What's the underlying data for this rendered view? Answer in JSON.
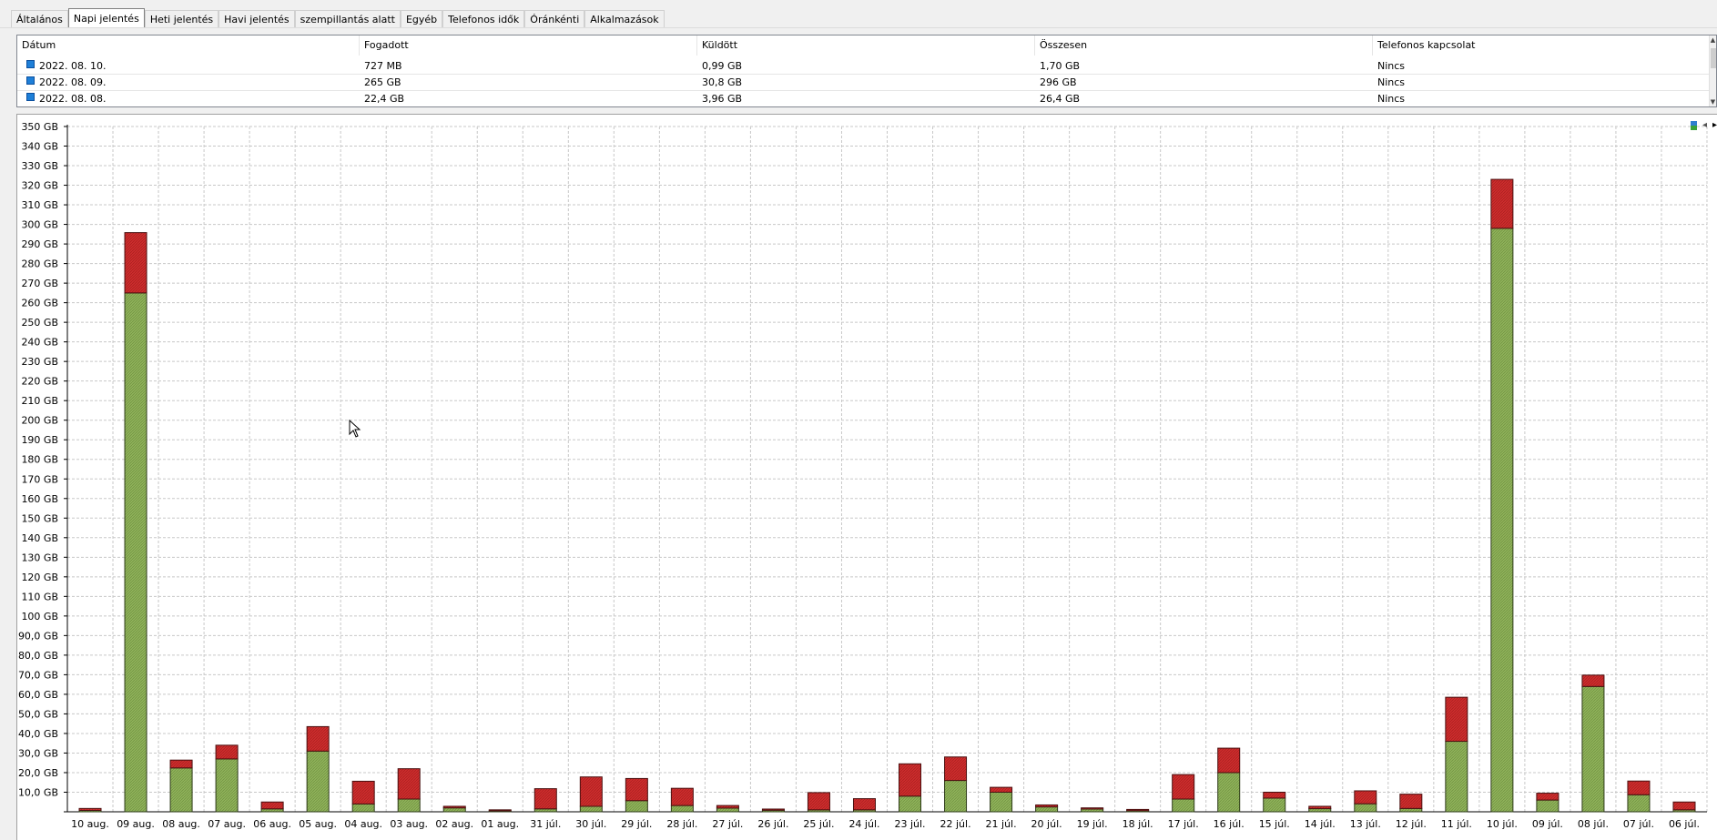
{
  "tabs": [
    {
      "label": "Általános",
      "active": false
    },
    {
      "label": "Napi jelentés",
      "active": true
    },
    {
      "label": "Heti jelentés",
      "active": false
    },
    {
      "label": "Havi jelentés",
      "active": false
    },
    {
      "label": "szempillantás alatt",
      "active": false
    },
    {
      "label": "Egyéb",
      "active": false
    },
    {
      "label": "Telefonos idők",
      "active": false
    },
    {
      "label": "Óránkénti",
      "active": false
    },
    {
      "label": "Alkalmazások",
      "active": false
    }
  ],
  "table": {
    "columns": [
      "Dátum",
      "Fogadott",
      "Küldött",
      "Összesen",
      "Telefonos kapcsolat"
    ],
    "rows": [
      [
        "2022. 08. 10.",
        "727 MB",
        "0,99 GB",
        "1,70 GB",
        "Nincs"
      ],
      [
        "2022. 08. 09.",
        "265 GB",
        "30,8 GB",
        "296 GB",
        "Nincs"
      ],
      [
        "2022. 08. 08.",
        "22,4 GB",
        "3,96 GB",
        "26,4 GB",
        "Nincs"
      ]
    ]
  },
  "chart_controls": {
    "legend_icon": "legend-icon",
    "prev_icon": "chevron-left-icon",
    "next_icon": "chevron-right-icon"
  },
  "chart_data": {
    "type": "bar",
    "stacked": true,
    "ylim": [
      0,
      350
    ],
    "ytick_labels": [
      "10,0 GB",
      "20,0 GB",
      "30,0 GB",
      "40,0 GB",
      "50,0 GB",
      "60,0 GB",
      "70,0 GB",
      "80,0 GB",
      "90,0 GB",
      "100 GB",
      "110 GB",
      "120 GB",
      "130 GB",
      "140 GB",
      "150 GB",
      "160 GB",
      "170 GB",
      "180 GB",
      "190 GB",
      "200 GB",
      "210 GB",
      "220 GB",
      "230 GB",
      "240 GB",
      "250 GB",
      "260 GB",
      "270 GB",
      "280 GB",
      "290 GB",
      "300 GB",
      "310 GB",
      "320 GB",
      "330 GB",
      "340 GB",
      "350 GB"
    ],
    "categories": [
      "10 aug.",
      "09 aug.",
      "08 aug.",
      "07 aug.",
      "06 aug.",
      "05 aug.",
      "04 aug.",
      "03 aug.",
      "02 aug.",
      "01 aug.",
      "31 júl.",
      "30 júl.",
      "29 júl.",
      "28 júl.",
      "27 júl.",
      "26 júl.",
      "25 júl.",
      "24 júl.",
      "23 júl.",
      "22 júl.",
      "21 júl.",
      "20 júl.",
      "19 júl.",
      "18 júl.",
      "17 júl.",
      "16 júl.",
      "15 júl.",
      "14 júl.",
      "13 júl.",
      "12 júl.",
      "11 júl.",
      "10 júl.",
      "09 júl.",
      "08 júl.",
      "07 júl.",
      "06 júl."
    ],
    "series": [
      {
        "color": "#8fb25a",
        "values": [
          0.7,
          265,
          22.4,
          27,
          1.5,
          31,
          4,
          6.5,
          2,
          0.5,
          1.5,
          2.8,
          5.7,
          3.2,
          1.9,
          0.8,
          1,
          1,
          8,
          16,
          10,
          2.5,
          1.4,
          0.6,
          6.5,
          20,
          7,
          1.6,
          4.1,
          1.7,
          36,
          298,
          6,
          64,
          8.7,
          1
        ]
      },
      {
        "color": "#cd2d2d",
        "values": [
          1.0,
          30.8,
          4.0,
          7,
          3.5,
          12.5,
          11.6,
          15.5,
          0.8,
          0.5,
          10.3,
          15,
          11.3,
          8.8,
          1.3,
          0.6,
          8.8,
          5.7,
          16.5,
          12,
          2.5,
          1,
          0.6,
          0.6,
          12.5,
          12.5,
          3,
          1.2,
          6.6,
          7.3,
          22.5,
          25,
          3.5,
          5.8,
          7,
          4
        ]
      }
    ],
    "grid": true
  },
  "chart_texts": {
    "tick_labels": []
  }
}
